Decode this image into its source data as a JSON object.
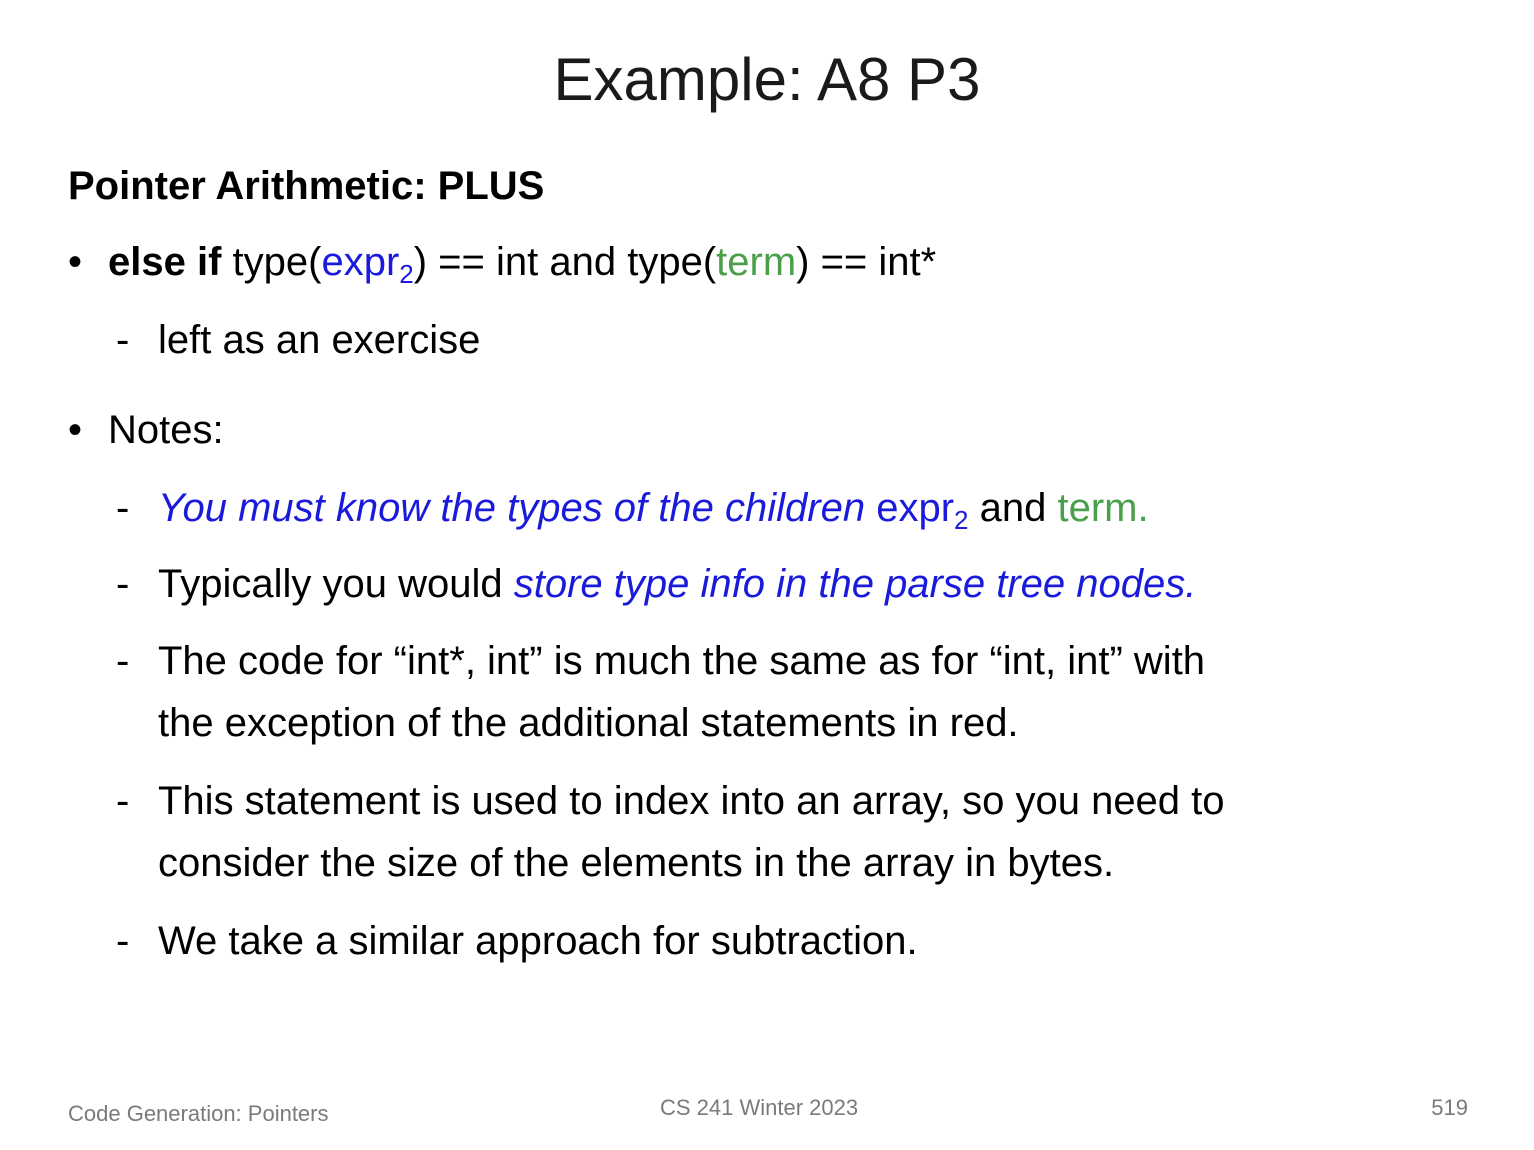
{
  "title": "Example: A8 P3",
  "heading": "Pointer Arithmetic: PLUS",
  "bullet1": {
    "kw": "else if",
    "t1": " type(",
    "expr": "expr",
    "sub": "2",
    "t2": ") == int and type(",
    "term": "term",
    "t3": ") == int*"
  },
  "bullet1_sub": "left as an exercise",
  "bullet2": "Notes:",
  "notes": {
    "n1_italic": "You must know the types of the children",
    "n1_expr": "expr",
    "n1_sub": "2",
    "n1_and": " and ",
    "n1_term": "term.",
    "n2_plain": "Typically you would ",
    "n2_italic": "store type info in the parse tree nodes.",
    "n3_line1": "The code for “int*, int” is much the same as for “int, int” with",
    "n3_line2": "the exception of the additional statements in red.",
    "n4_line1": "This statement is used to index into an array, so you need to",
    "n4_line2": "consider the size of the elements in the array in bytes.",
    "n5": "We take a similar approach for subtraction."
  },
  "footer": {
    "left": "Code Generation: Pointers",
    "center": "CS 241 Winter 2023",
    "right": "519"
  }
}
